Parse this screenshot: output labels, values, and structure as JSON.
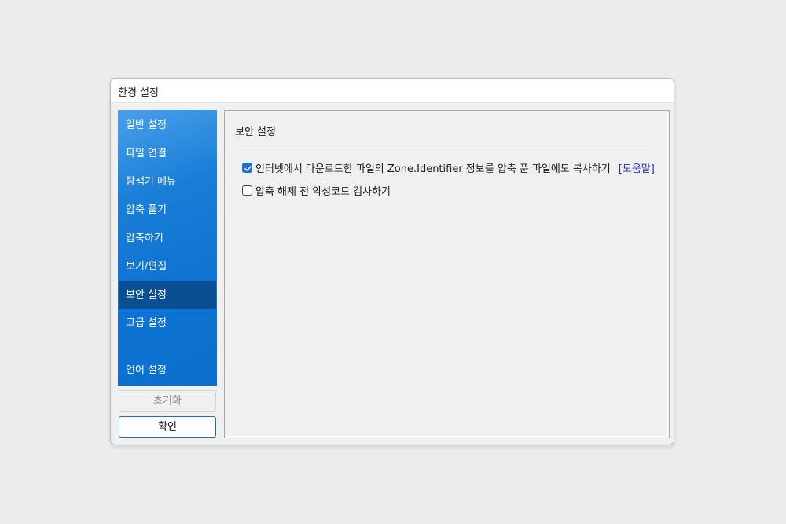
{
  "window": {
    "title": "환경 설정"
  },
  "sidebar": {
    "items": [
      {
        "label": "일반 설정"
      },
      {
        "label": "파일 연결"
      },
      {
        "label": "탐색기 메뉴"
      },
      {
        "label": "압축 풀기"
      },
      {
        "label": "압축하기"
      },
      {
        "label": "보기/편집"
      },
      {
        "label": "보안 설정"
      },
      {
        "label": "고급 설정"
      },
      {
        "label": "언어 설정"
      }
    ],
    "active_item": "보안 설정"
  },
  "buttons": {
    "reset_label": "초기화",
    "ok_label": "확인"
  },
  "panel": {
    "section_title": "보안 설정",
    "options": [
      {
        "label": "인터넷에서 다운로드한 파일의 Zone.Identifier 정보를 압축 푼 파일에도 복사하기",
        "checked": true
      },
      {
        "label": "압축 해제 전 악성코드 검사하기",
        "checked": false
      }
    ],
    "help_link": "[도움말]"
  },
  "colors": {
    "sidebar_accent": "#0f74d3",
    "sidebar_active": "#0a4f92",
    "checkbox_checked": "#1f6fcd",
    "link": "#2b2bc4"
  }
}
